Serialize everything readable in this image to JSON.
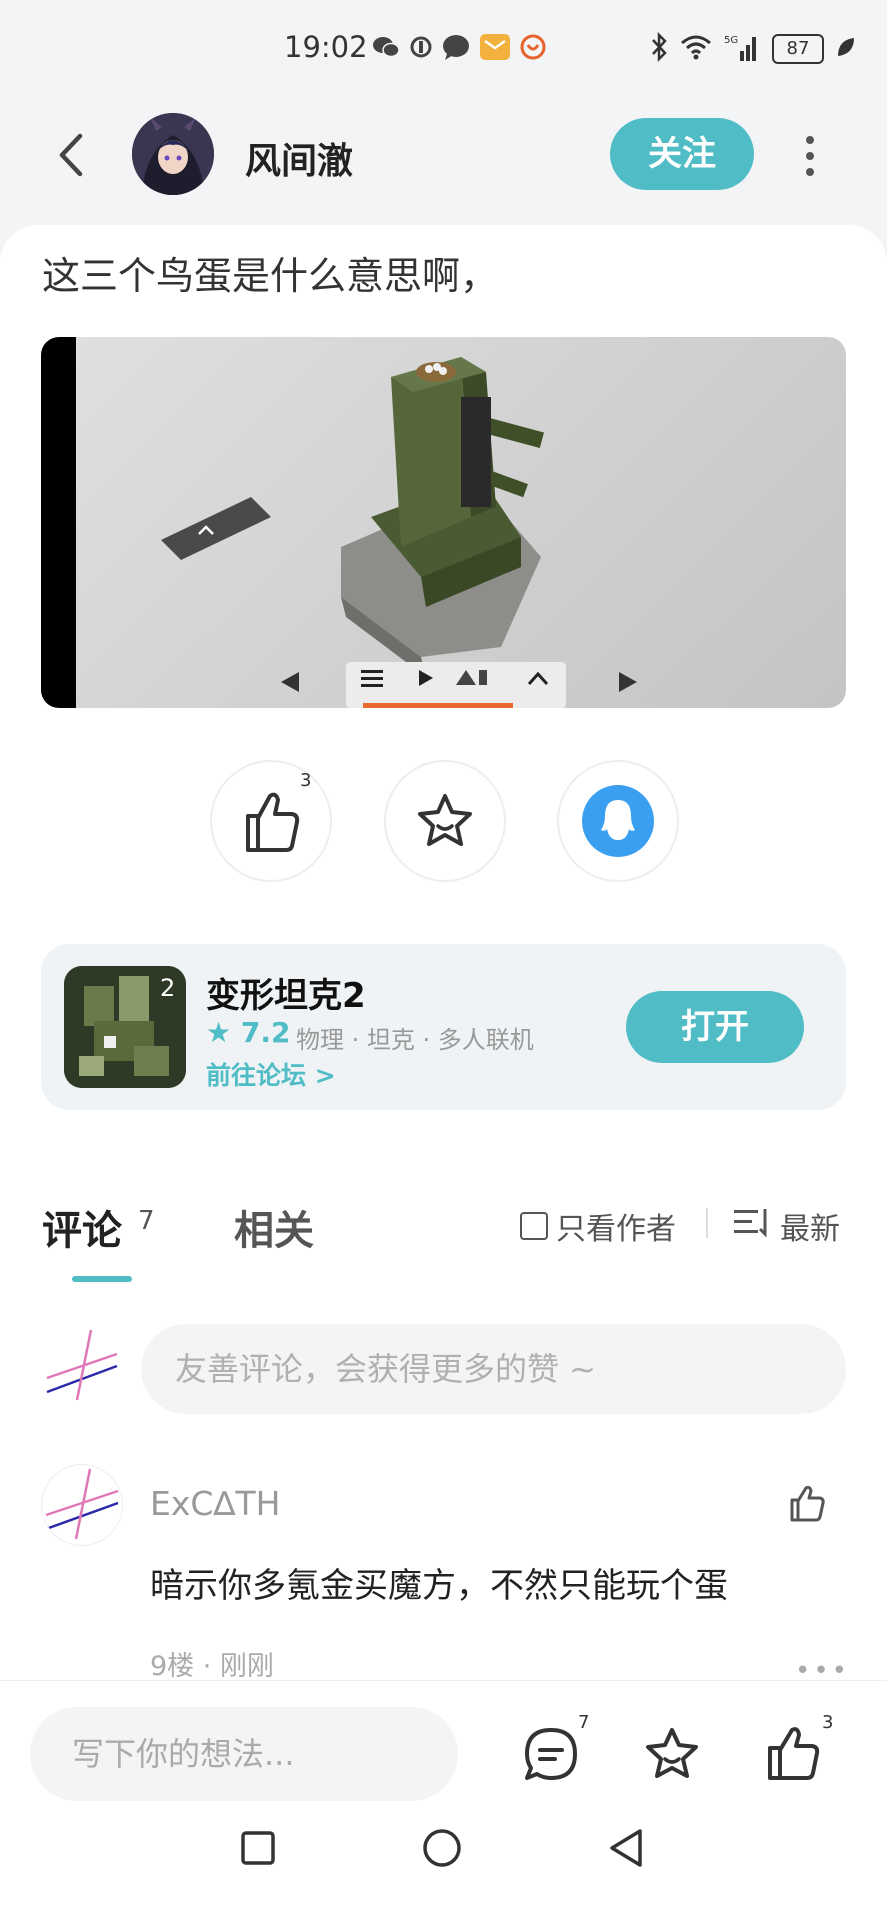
{
  "status_bar": {
    "time": "19:02",
    "battery": "87"
  },
  "header": {
    "username": "风间澈",
    "follow_label": "关注"
  },
  "post": {
    "title": "这三个鸟蛋是什么意思啊，",
    "like_count": "3"
  },
  "game": {
    "name": "变形坦克2",
    "rating": "7.2",
    "tags": "物理 · 坦克 · 多人联机",
    "forum_link": "前往论坛 >",
    "open_label": "打开"
  },
  "comments_section": {
    "tab_comments": "评论",
    "tab_comments_count": "7",
    "tab_related": "相关",
    "only_author": "只看作者",
    "sort": "最新",
    "input_placeholder": "友善评论，会获得更多的赞 ~"
  },
  "comment": {
    "author": "ExC∆TH",
    "text": "暗示你多氪金买魔方，不然只能玩个蛋",
    "meta": "9楼 · 刚刚"
  },
  "bottom_bar": {
    "write_placeholder": "写下你的想法...",
    "comment_count": "7",
    "like_count": "3"
  },
  "colors": {
    "accent": "#4fbcc6"
  }
}
